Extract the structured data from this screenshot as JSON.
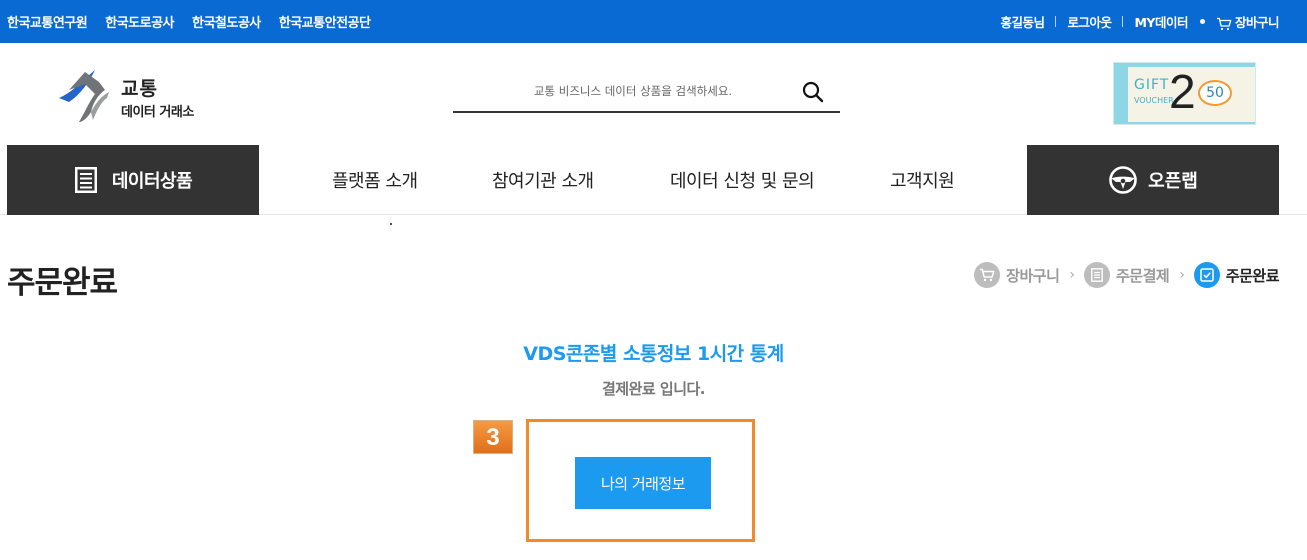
{
  "topbar": {
    "left_links": [
      "한국교통연구원",
      "한국도로공사",
      "한국철도공사",
      "한국교통안전공단"
    ],
    "user_name": "홍길동님",
    "logout": "로그아웃",
    "my_data": "MY데이터",
    "cart": "장바구니"
  },
  "logo": {
    "line1": "교통",
    "line2": "데이터 거래소"
  },
  "search": {
    "placeholder": "교통 비즈니스 데이터 상품을 검색하세요."
  },
  "gift_banner": {
    "gift": "GIFT",
    "voucher": "VOUCHER",
    "number": "2",
    "badge": "50"
  },
  "nav": {
    "data_products": "데이터상품",
    "items": [
      "플랫폼 소개",
      "참여기관 소개",
      "데이터 신청 및 문의",
      "고객지원"
    ],
    "openlab": "오픈랩"
  },
  "page": {
    "title": "주문완료",
    "steps": [
      "장바구니",
      "주문결제",
      "주문완료"
    ]
  },
  "content": {
    "product_name": "VDS콘존별 소통정보 1시간 통계",
    "message": "결제완료 입니다.",
    "step_number": "3",
    "button_label": "나의 거래정보"
  },
  "colors": {
    "topbar": "#0a6ad4",
    "accent": "#1b9af0",
    "nav_dark": "#333333",
    "highlight": "#f08a2a"
  }
}
